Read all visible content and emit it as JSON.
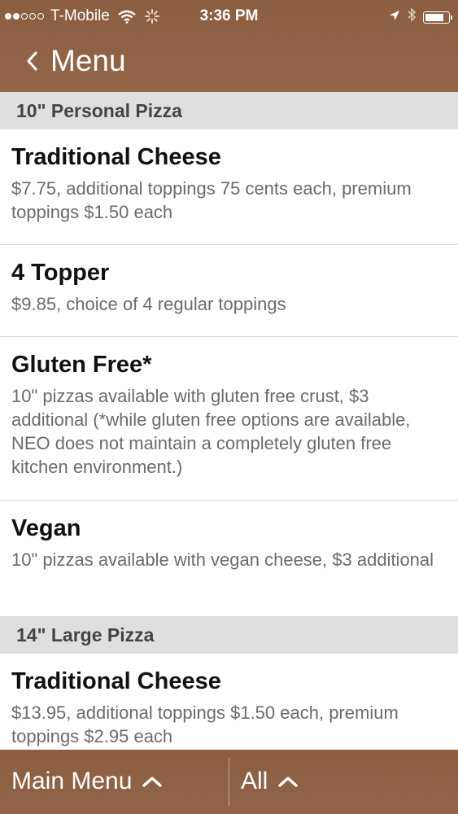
{
  "status_bar": {
    "carrier": "T-Mobile",
    "time": "3:36 PM",
    "signal_filled": 2,
    "signal_total": 5,
    "battery_level": 0.7,
    "icons": [
      "wifi-icon",
      "loading-icon",
      "location-arrow-icon",
      "bluetooth-icon",
      "battery-icon"
    ]
  },
  "nav": {
    "back_label": "Menu"
  },
  "sections": [
    {
      "title": "10\" Personal Pizza",
      "items": [
        {
          "name": "Traditional Cheese",
          "description": "$7.75, additional toppings 75 cents each, premium toppings $1.50 each"
        },
        {
          "name": "4 Topper",
          "description": "$9.85, choice of 4 regular toppings"
        },
        {
          "name": "Gluten Free*",
          "description": "10\" pizzas available with gluten free crust, $3 additional (*while gluten free options are available, NEO does not maintain a completely gluten free kitchen environment.)"
        },
        {
          "name": "Vegan",
          "description": "10\" pizzas available with vegan cheese, $3 additional"
        }
      ]
    },
    {
      "title": "14\" Large Pizza",
      "items": [
        {
          "name": "Traditional Cheese",
          "description": "$13.95, additional toppings $1.50 each, premium toppings $2.95 each"
        }
      ]
    }
  ],
  "bottom_bar": {
    "main_menu_label": "Main Menu",
    "filter_label": "All"
  },
  "colors": {
    "bar_brown": "#8f6043",
    "section_gray": "#dfdfdf"
  }
}
